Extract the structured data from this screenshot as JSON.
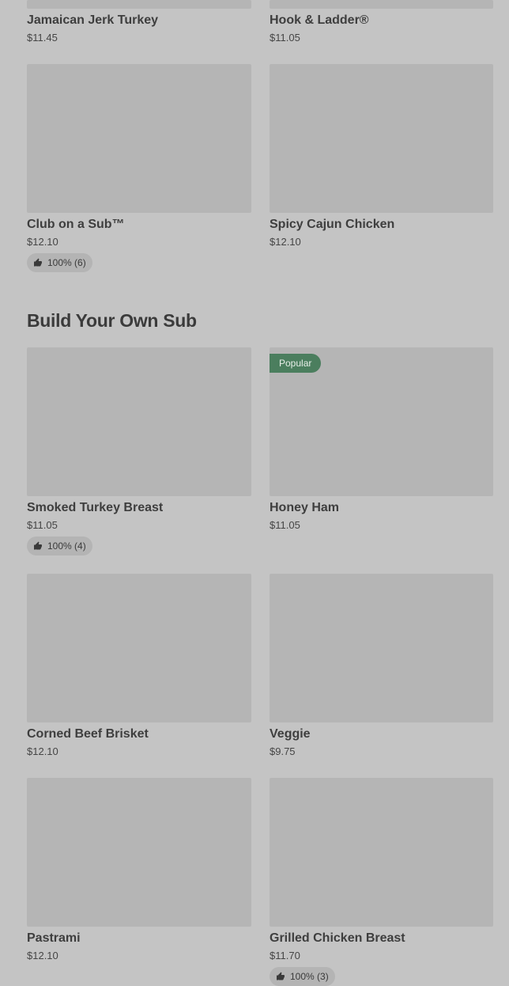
{
  "top_items": [
    {
      "name": "Jamaican Jerk Turkey",
      "price": "$11.45"
    },
    {
      "name": "Hook & Ladder®",
      "price": "$11.05"
    },
    {
      "name": "Club on a Sub™",
      "price": "$12.10",
      "rating": "100% (6)"
    },
    {
      "name": "Spicy Cajun Chicken",
      "price": "$12.10"
    }
  ],
  "build_section": {
    "title": "Build Your Own Sub",
    "items": [
      {
        "name": "Smoked Turkey Breast",
        "price": "$11.05",
        "rating": "100% (4)"
      },
      {
        "name": "Honey Ham",
        "price": "$11.05",
        "badge": "Popular"
      },
      {
        "name": "Corned Beef Brisket",
        "price": "$12.10"
      },
      {
        "name": "Veggie",
        "price": "$9.75"
      },
      {
        "name": "Pastrami",
        "price": "$12.10"
      },
      {
        "name": "Grilled Chicken Breast",
        "price": "$11.70",
        "rating": "100% (3)"
      }
    ]
  },
  "icons": {
    "rating": "thumbs-up-icon"
  }
}
